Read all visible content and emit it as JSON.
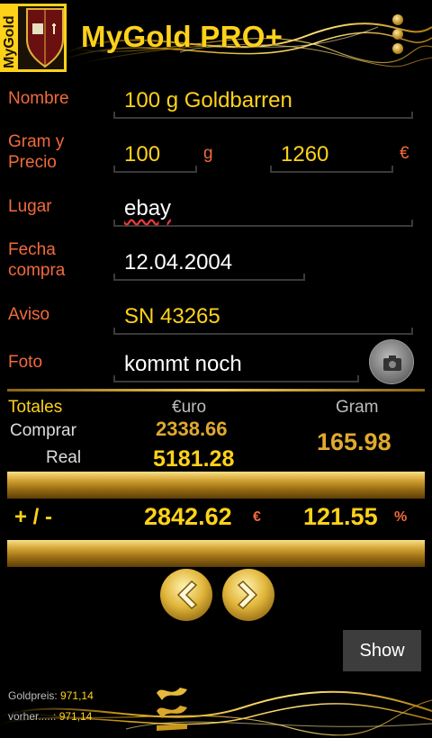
{
  "app": {
    "title": "MyGold PRO+",
    "logo_text": "MyGold"
  },
  "form": {
    "name": {
      "label": "Nombre",
      "value": "100 g Goldbarren"
    },
    "gram_price": {
      "label_1": "Gram y",
      "label_2": "Precio",
      "grams": "100",
      "grams_unit": "g",
      "price": "1260",
      "price_unit": "€"
    },
    "place": {
      "label": "Lugar",
      "value": "ebay"
    },
    "date": {
      "label_1": "Fecha",
      "label_2": "compra",
      "value": "12.04.2004"
    },
    "note": {
      "label": "Aviso",
      "value": "SN 43265"
    },
    "photo": {
      "label": "Foto",
      "value": "kommt noch"
    }
  },
  "totals": {
    "header": "Totales",
    "col_euro": "€uro",
    "col_gram": "Gram",
    "buy_label": "Comprar",
    "buy_value": "2338.66",
    "real_label": "Real",
    "real_value": "5181.28",
    "gram_value": "165.98",
    "diff_label": "+ / -",
    "diff_value": "2842.62",
    "diff_unit": "€",
    "diff_percent": "121.55",
    "diff_percent_unit": "%"
  },
  "actions": {
    "show_label": "Show"
  },
  "footer": {
    "gold_price_label": "Goldpreis:",
    "gold_price_value": "971,14",
    "previous_label": "vorher.....:",
    "previous_value": "971,14"
  },
  "colors": {
    "accent_gold": "#ffd21a",
    "label_orange": "#f26a3c",
    "background": "#000000"
  },
  "icons": {
    "menu": "overflow-menu-icon",
    "camera": "camera-icon",
    "prev": "chevron-left-icon",
    "next": "chevron-right-icon"
  }
}
